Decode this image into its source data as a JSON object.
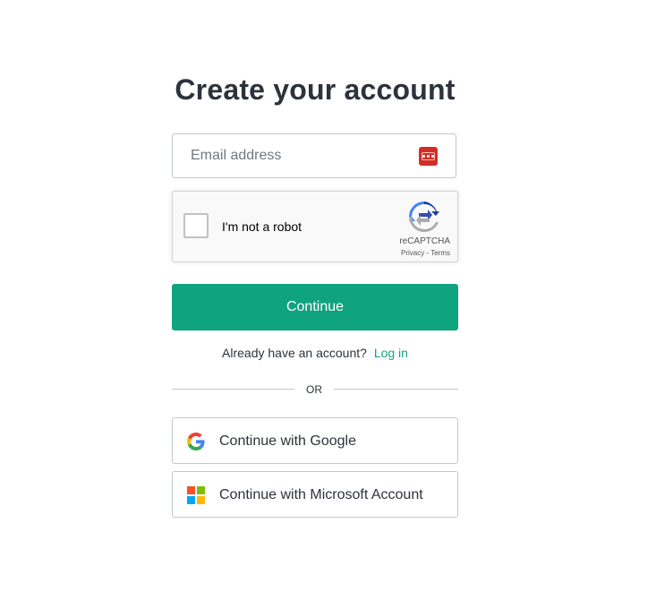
{
  "title": "Create your account",
  "email": {
    "placeholder": "Email address",
    "value": "",
    "password_manager_icon": "password-manager-icon"
  },
  "recaptcha": {
    "label": "I'm not a robot",
    "brand": "reCAPTCHA",
    "privacy": "Privacy",
    "separator": " - ",
    "terms": "Terms",
    "checked": false
  },
  "continue_label": "Continue",
  "login_prompt": {
    "text": "Already have an account?",
    "link": "Log in"
  },
  "divider_text": "OR",
  "social": {
    "google_label": "Continue with Google",
    "google_icon": "google-icon",
    "microsoft_label": "Continue with Microsoft Account",
    "microsoft_icon": "microsoft-icon"
  },
  "colors": {
    "accent": "#10a37f",
    "text": "#2d333a",
    "border": "#c2c8d0",
    "password_manager": "#d32d27"
  }
}
